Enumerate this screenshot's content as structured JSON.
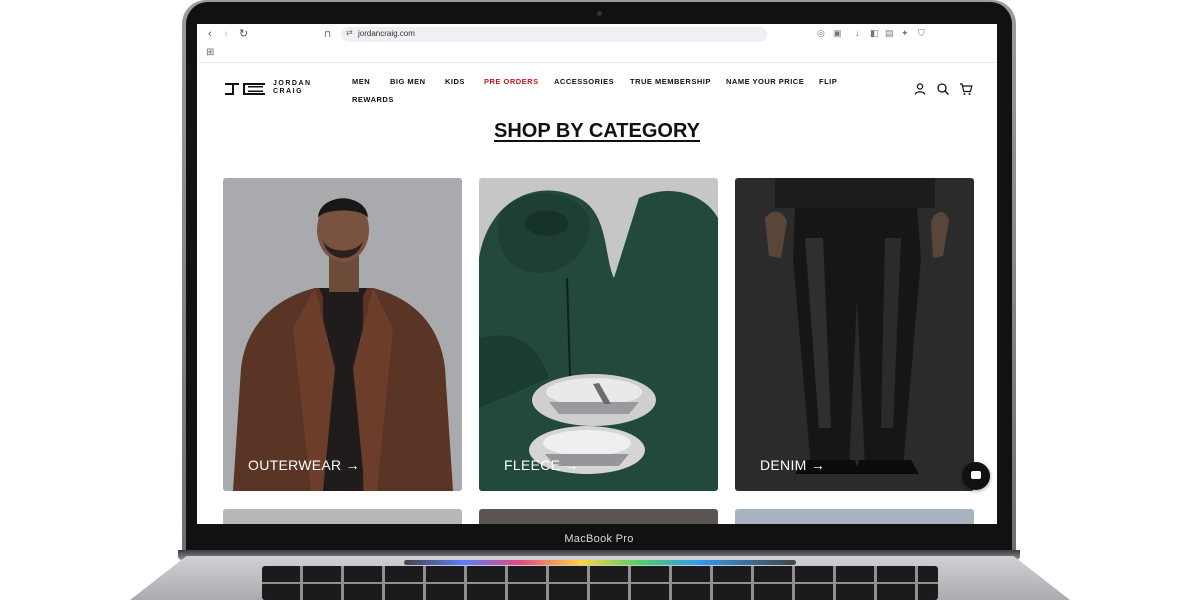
{
  "device": {
    "label": "MacBook Pro"
  },
  "browser": {
    "url": "jordancraig.com",
    "nav_icons": [
      "back-icon",
      "forward-icon",
      "reload-icon",
      "bookmark-icon"
    ]
  },
  "site": {
    "logo_line1": "JORDAN",
    "logo_line2": "CRAIG",
    "nav": [
      "MEN",
      "BIG MEN",
      "KIDS",
      "PRE ORDERS",
      "ACCESSORIES",
      "TRUE MEMBERSHIP",
      "NAME YOUR PRICE",
      "FLIP",
      "REWARDS"
    ],
    "nav_highlight": "PRE ORDERS",
    "nav_highlight_color": "#c4161c",
    "header_icons": [
      "account-icon",
      "search-icon",
      "cart-icon"
    ]
  },
  "main": {
    "title": "SHOP BY CATEGORY",
    "categories": [
      {
        "label": "OUTERWEAR →"
      },
      {
        "label": "FLEECE →"
      },
      {
        "label": "DENIM →"
      }
    ]
  }
}
